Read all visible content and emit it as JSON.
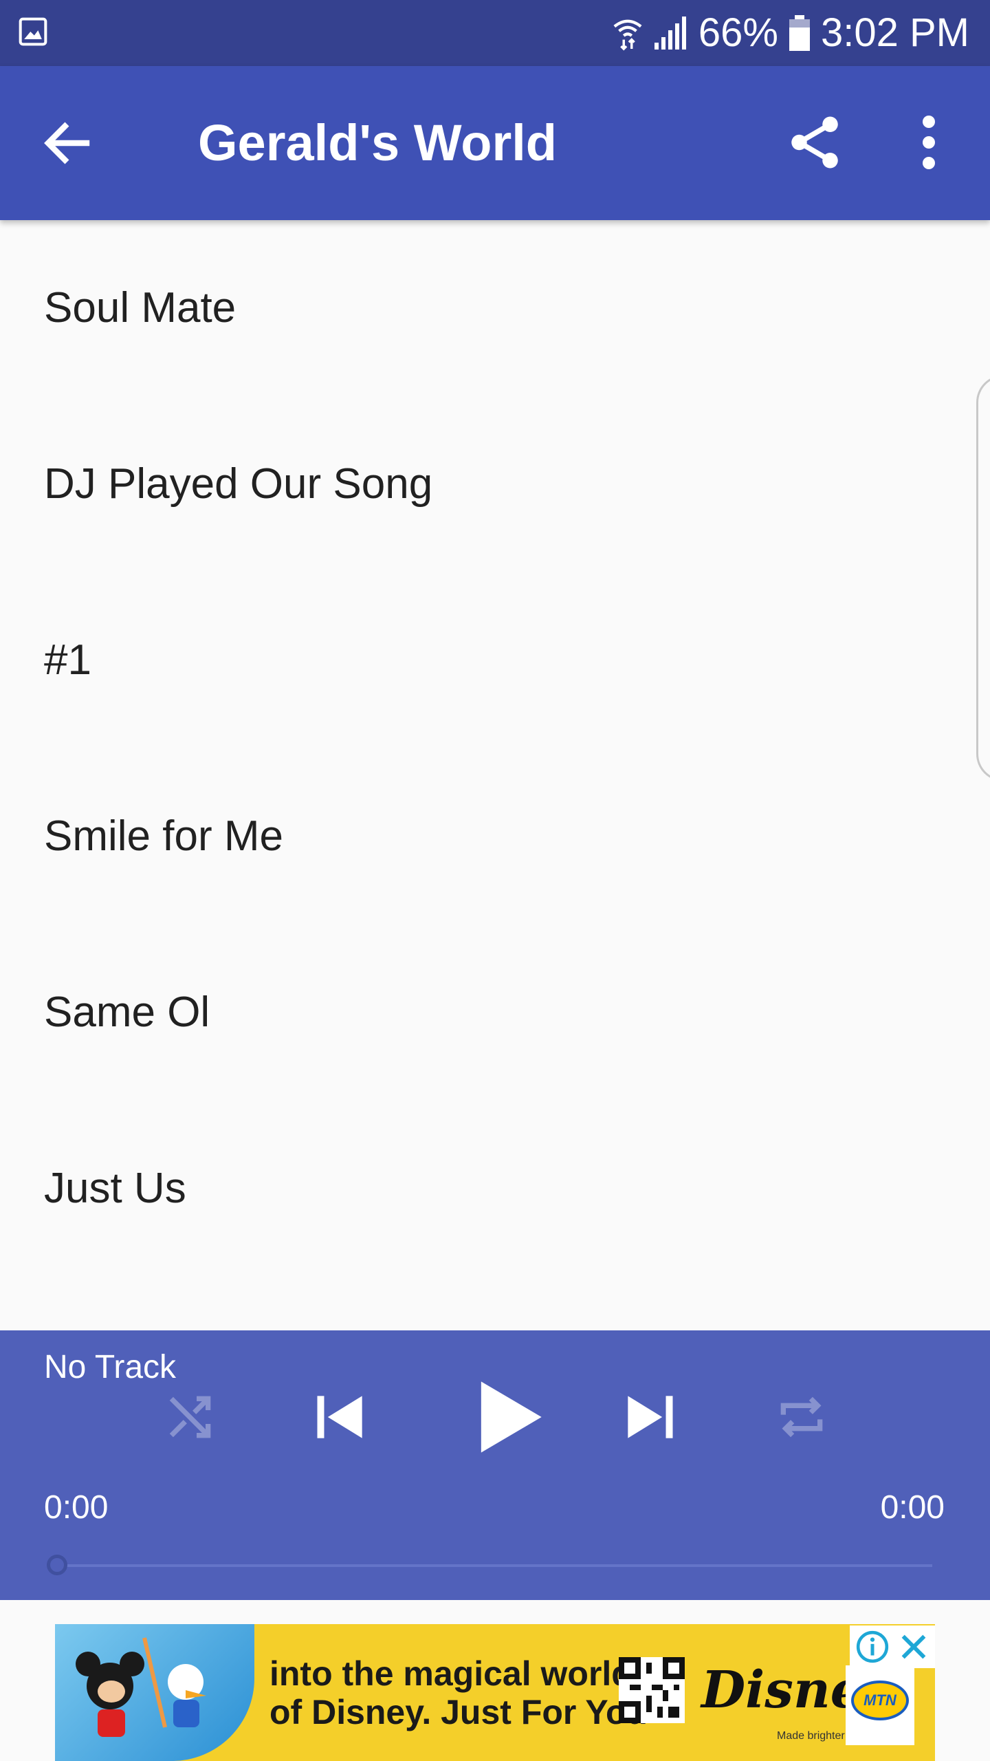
{
  "status_bar": {
    "battery": "66%",
    "time": "3:02 PM"
  },
  "app_bar": {
    "title": "Gerald's World"
  },
  "tracks": [
    {
      "label": "Soul Mate"
    },
    {
      "label": "DJ Played Our Song"
    },
    {
      "label": "#1"
    },
    {
      "label": "Smile for Me"
    },
    {
      "label": "Same Ol"
    },
    {
      "label": "Just Us"
    }
  ],
  "player": {
    "track_name": "No Track",
    "time_elapsed": "0:00",
    "time_total": "0:00",
    "progress": 0
  },
  "ad": {
    "line1": "into the magical world",
    "line2": "of Disney. Just For You",
    "brand": "Disney",
    "tagline": "Made brighter by",
    "partner": "MTN"
  },
  "colors": {
    "status_bar": "#35418f",
    "app_bar": "#3f51b5",
    "player": "#5060b9",
    "ad_background": "#f4cf2a"
  }
}
